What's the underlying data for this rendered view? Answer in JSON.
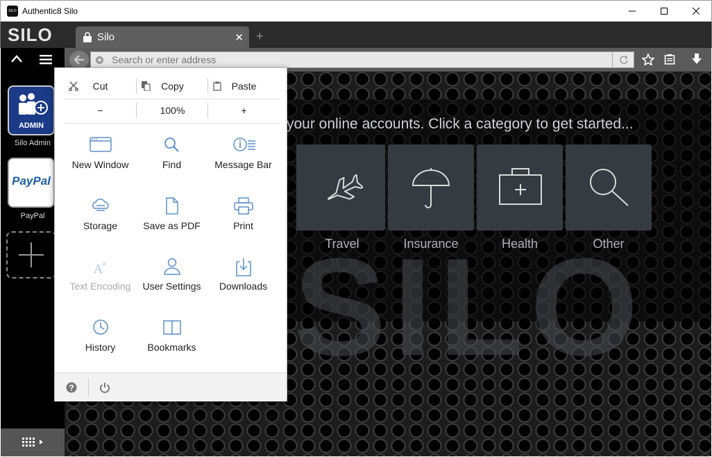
{
  "window": {
    "title": "Authentic8 Silo",
    "logo_text": "SILO",
    "controls": [
      "minimize",
      "maximize",
      "close"
    ]
  },
  "browser": {
    "brand": "SILO",
    "tab": {
      "label": "Silo"
    },
    "address_bar": {
      "placeholder": "Search or enter address",
      "value": ""
    }
  },
  "sidebar": {
    "apps": [
      {
        "label": "Silo Admin",
        "badge": "ADMIN"
      },
      {
        "label": "PayPal",
        "logo_text": "PayPal"
      }
    ]
  },
  "page": {
    "tagline": "your online accounts. Click a category to get started...",
    "watermark": "SILO",
    "categories": [
      {
        "label": "Travel",
        "icon": "airplane-icon"
      },
      {
        "label": "Insurance",
        "icon": "umbrella-icon"
      },
      {
        "label": "Health",
        "icon": "first-aid-kit-icon"
      },
      {
        "label": "Other",
        "icon": "magnifier-icon"
      }
    ]
  },
  "menu": {
    "edit": {
      "cut": "Cut",
      "copy": "Copy",
      "paste": "Paste"
    },
    "zoom": {
      "decrease": "−",
      "level": "100%",
      "increase": "+"
    },
    "items": [
      {
        "label": "New Window",
        "icon": "window-icon",
        "enabled": true
      },
      {
        "label": "Find",
        "icon": "search-icon",
        "enabled": true
      },
      {
        "label": "Message Bar",
        "icon": "info-list-icon",
        "enabled": true
      },
      {
        "label": "Storage",
        "icon": "cloud-storage-icon",
        "enabled": true
      },
      {
        "label": "Save as PDF",
        "icon": "document-icon",
        "enabled": true
      },
      {
        "label": "Print",
        "icon": "printer-icon",
        "enabled": true
      },
      {
        "label": "Text Encoding",
        "icon": "text-encoding-icon",
        "enabled": false
      },
      {
        "label": "User Settings",
        "icon": "user-icon",
        "enabled": true
      },
      {
        "label": "Downloads",
        "icon": "download-icon",
        "enabled": true
      },
      {
        "label": "History",
        "icon": "clock-icon",
        "enabled": true
      },
      {
        "label": "Bookmarks",
        "icon": "book-icon",
        "enabled": true
      }
    ],
    "footer": [
      "help-icon",
      "power-icon"
    ]
  }
}
